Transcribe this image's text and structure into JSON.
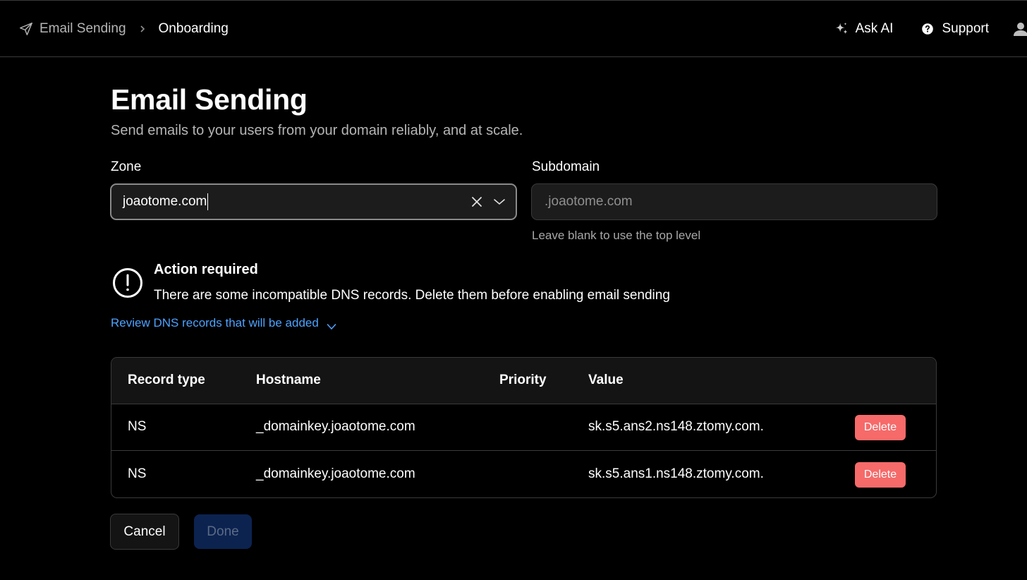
{
  "breadcrumb": {
    "parent": "Email Sending",
    "current": "Onboarding"
  },
  "header_actions": {
    "ask_ai": "Ask AI",
    "support": "Support"
  },
  "page": {
    "title": "Email Sending",
    "subtitle": "Send emails to your users from your domain reliably, and at scale."
  },
  "form": {
    "zone_label": "Zone",
    "zone_value": "joaotome.com",
    "subdomain_label": "Subdomain",
    "subdomain_placeholder": ".joaotome.com",
    "subdomain_value": "",
    "subdomain_helper": "Leave blank to use the top level"
  },
  "alert": {
    "title": "Action required",
    "message": "There are some incompatible DNS records. Delete them before enabling email sending",
    "review_link": "Review DNS records that will be added"
  },
  "table": {
    "headers": [
      "Record type",
      "Hostname",
      "Priority",
      "Value"
    ],
    "rows": [
      {
        "type": "NS",
        "hostname": "_domainkey.joaotome.com",
        "priority": "",
        "value": "sk.s5.ans2.ns148.ztomy.com.",
        "action": "Delete"
      },
      {
        "type": "NS",
        "hostname": "_domainkey.joaotome.com",
        "priority": "",
        "value": "sk.s5.ans1.ns148.ztomy.com.",
        "action": "Delete"
      }
    ]
  },
  "buttons": {
    "cancel": "Cancel",
    "done": "Done"
  },
  "colors": {
    "background": "#000000",
    "link": "#4ea2ff",
    "danger": "#f66a6a",
    "primary_disabled": "#0c2350"
  },
  "icons": [
    "paper-plane-icon",
    "chevron-right-icon",
    "sparkle-icon",
    "question-circle-icon",
    "user-icon",
    "clear-icon",
    "chevron-down-icon",
    "alert-circle-icon"
  ]
}
